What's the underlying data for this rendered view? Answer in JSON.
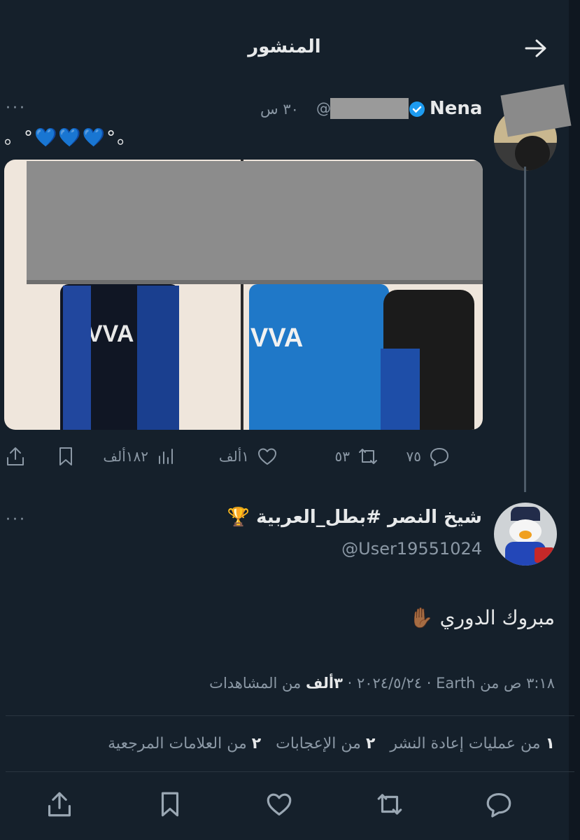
{
  "header": {
    "title": "المنشور",
    "back_icon": "arrow-right-icon"
  },
  "parent_post": {
    "display_name": "Nena",
    "handle_prefix": "@",
    "time": "٣٠ س",
    "text": "。°💙💙💙°。",
    "actions": {
      "replies": "٧٥",
      "reposts": "٥٣",
      "likes": "١ألف",
      "views": "١٨٢ألف"
    }
  },
  "reply_post": {
    "display_name": "شيخ النصر #بطل_العربية 🏆",
    "handle": "@User19551024",
    "text": "مبروك الدوري ✋🏾",
    "meta": {
      "datetime": "٣:١٨ ص من Earth · ٢٠٢٤/٥/٢٤",
      "views_count": "٣ألف",
      "views_label": "من المشاهدات"
    },
    "engagement": {
      "reposts_count": "١",
      "reposts_label": "من عمليات إعادة النشر",
      "likes_count": "٢",
      "likes_label": "من الإعجابات",
      "bookmarks_count": "٢",
      "bookmarks_label": "من العلامات المرجعية"
    }
  },
  "colors": {
    "background": "#15202b",
    "text": "#e7e9ea",
    "muted": "#8b98a5",
    "verified": "#1d9bf0"
  }
}
